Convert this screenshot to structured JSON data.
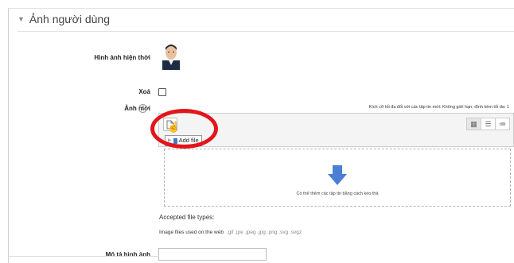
{
  "section": {
    "title": "Ảnh người dùng",
    "chevron_icon": "chevron-down-icon"
  },
  "current_picture": {
    "label": "Hình ảnh hiện thời",
    "image_icon": "user-portrait-image"
  },
  "delete": {
    "label": "Xoá",
    "checked": false
  },
  "new_picture": {
    "label": "Ảnh mới",
    "help_icon": "?",
    "size_limit": "Kích cỡ tối đa đối với các tập tin mới: Không giới hạn, đính kèm tối đa: 1"
  },
  "filepicker": {
    "add_file_icon": "add-file-icon",
    "tooltip": "Add file",
    "view_buttons": [
      {
        "icon": "grid-view-icon",
        "glyph": "▦",
        "active": true
      },
      {
        "icon": "list-view-icon",
        "glyph": "☰",
        "active": false
      },
      {
        "icon": "tree-view-icon",
        "glyph": "≔",
        "active": false
      }
    ],
    "drop_message": "Có thể thêm các tập tin bằng cách kéo thả",
    "drop_icon": "down-arrow-icon"
  },
  "accepted": {
    "title": "Accepted file types:",
    "group": "Image files used on the web",
    "extensions": ".gif .jpe .jpeg .jpg .png .svg .svgz"
  },
  "image_description": {
    "label": "Mô tả hình ảnh",
    "value": ""
  },
  "colors": {
    "annotation": "#e3151c",
    "drop_arrow": "#4a7fd4"
  }
}
